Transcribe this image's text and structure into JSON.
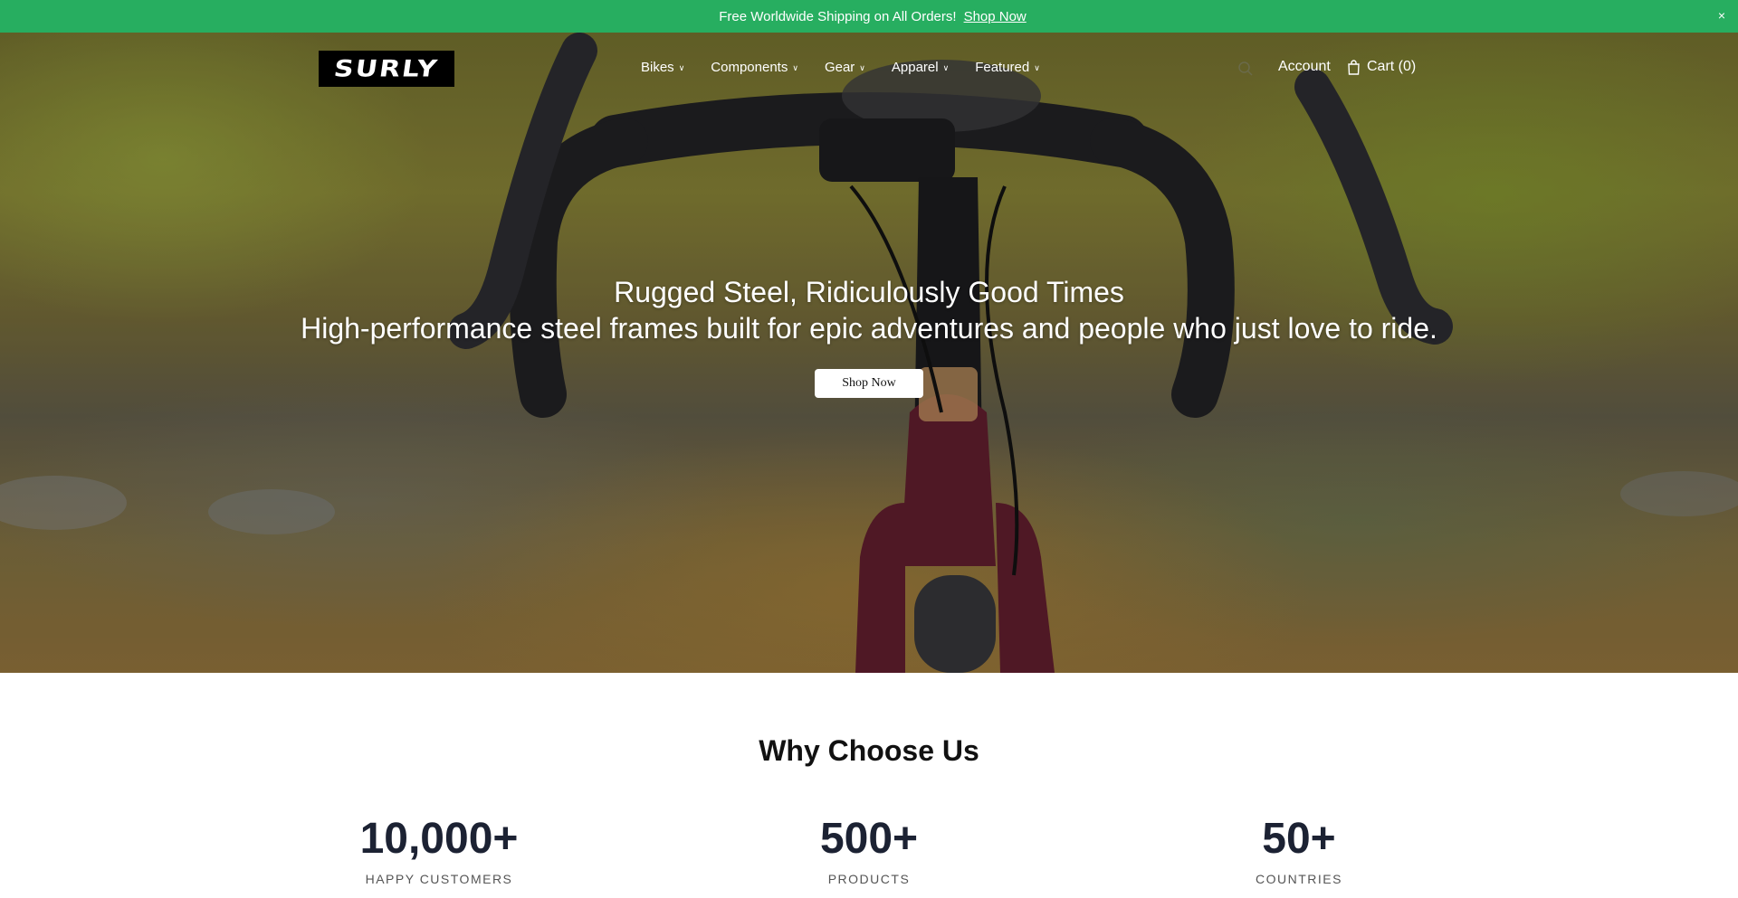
{
  "announcement": {
    "glyph": "",
    "text": "Free Worldwide Shipping on All Orders!",
    "link": "Shop Now",
    "close": "×"
  },
  "header": {
    "logo": "SURLY",
    "nav": [
      {
        "label": "Bikes"
      },
      {
        "label": "Components"
      },
      {
        "label": "Gear"
      },
      {
        "label": "Apparel"
      },
      {
        "label": "Featured"
      }
    ],
    "account": "Account",
    "cart": "Cart (0)"
  },
  "hero": {
    "title": "Rugged Steel, Ridiculously Good Times",
    "subtitle": "High-performance steel frames built for epic adventures and people who just love to ride.",
    "button": "Shop Now"
  },
  "why": {
    "title": "Why Choose Us",
    "stats": [
      {
        "value": "10,000+",
        "label": "HAPPY CUSTOMERS"
      },
      {
        "value": "500+",
        "label": "PRODUCTS"
      },
      {
        "value": "50+",
        "label": "COUNTRIES"
      }
    ]
  },
  "colors": {
    "announce_bg": "#27ae60",
    "stat_number": "#1c2233"
  }
}
